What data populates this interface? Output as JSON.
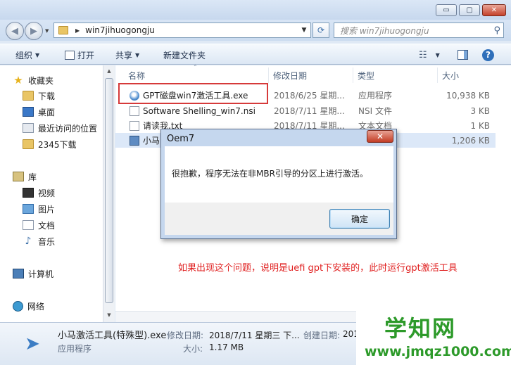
{
  "window": {
    "minimize": "▭",
    "maximize": "▢",
    "close": "✕"
  },
  "nav": {
    "back_icon": "back-arrow-icon",
    "forward_icon": "forward-arrow-icon",
    "address_path": "win7jihuogongju",
    "search_placeholder": "搜索 win7jihuogongju"
  },
  "toolbar": {
    "organize": "组织",
    "open": "打开",
    "share": "共享",
    "new_folder": "新建文件夹"
  },
  "sidebar": {
    "favorites": "收藏夹",
    "downloads": "下载",
    "desktop": "桌面",
    "recent": "最近访问的位置",
    "dl2345": "2345下载",
    "libraries": "库",
    "videos": "视频",
    "pictures": "图片",
    "documents": "文档",
    "music": "音乐",
    "computer": "计算机",
    "network": "网络"
  },
  "columns": {
    "name": "名称",
    "date": "修改日期",
    "type": "类型",
    "size": "大小"
  },
  "files": [
    {
      "name": "GPT磁盘win7激活工具.exe",
      "date": "2018/6/25 星期...",
      "type": "应用程序",
      "size": "10,938 KB"
    },
    {
      "name": "Software Shelling_win7.nsi",
      "date": "2018/7/11 星期...",
      "type": "NSI 文件",
      "size": "3 KB"
    },
    {
      "name": "请读我.txt",
      "date": "2018/7/11 星期...",
      "type": "文本文档",
      "size": "1 KB"
    },
    {
      "name": "小马",
      "date": "",
      "type": "",
      "size": "1,206 KB"
    }
  ],
  "dialog": {
    "title": "Oem7",
    "close": "✕",
    "message": "很抱歉，程序无法在非MBR引导的分区上进行激活。",
    "ok": "确定"
  },
  "annotation": "如果出现这个问题，说明是uefi gpt下安装的，此时运行gpt激活工具",
  "details": {
    "filename": "小马激活工具(特殊型).exe",
    "modified_label": "修改日期:",
    "modified_value": "2018/7/11 星期三 下...",
    "created_label": "创建日期:",
    "created_value": "201",
    "type": "应用程序",
    "size_label": "大小:",
    "size_value": "1.17 MB"
  },
  "watermark": {
    "title": "学知网",
    "url": "www.jmqz1000.com"
  }
}
